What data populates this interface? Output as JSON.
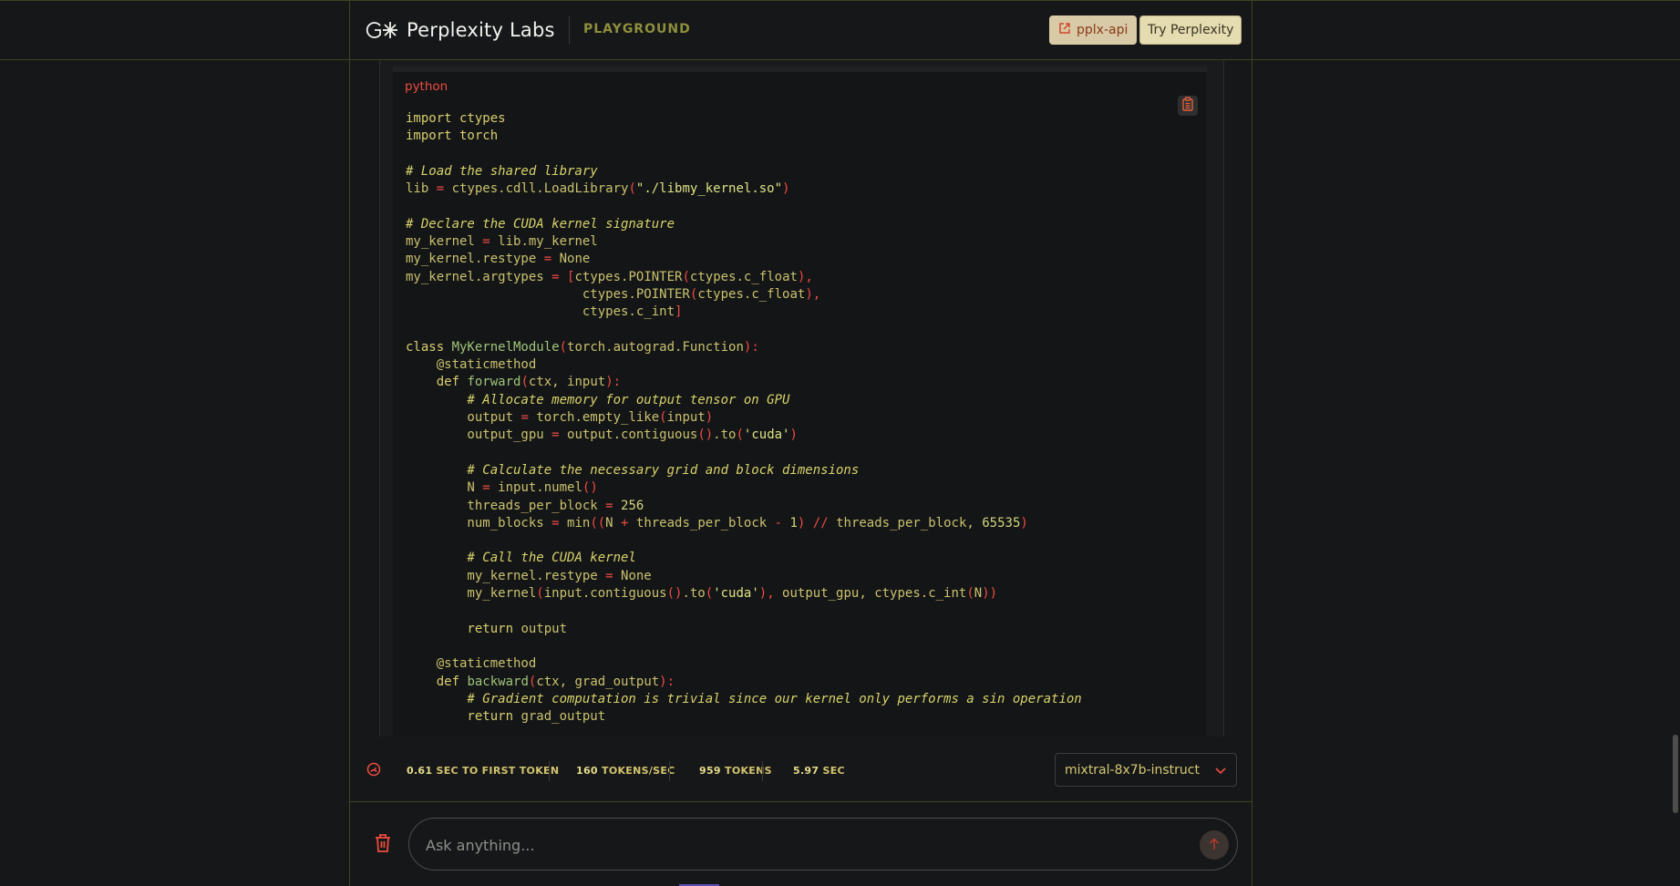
{
  "header": {
    "brand": "Perplexity Labs",
    "section": "PLAYGROUND",
    "api_button": "pplx-api",
    "try_button": "Try Perplexity"
  },
  "code": {
    "language": "python",
    "lines": [
      [
        [
          "kw",
          "import ctypes"
        ]
      ],
      [
        [
          "kw",
          "import torch"
        ]
      ],
      [],
      [
        [
          "cm",
          "# Load the shared library"
        ]
      ],
      [
        [
          "plain",
          "lib "
        ],
        [
          "op",
          "="
        ],
        [
          "plain",
          " ctypes.cdll.LoadLibrary"
        ],
        [
          "op",
          "("
        ],
        [
          "str",
          "\"./libmy_kernel.so\""
        ],
        [
          "op",
          ")"
        ]
      ],
      [],
      [
        [
          "cm",
          "# Declare the CUDA kernel signature"
        ]
      ],
      [
        [
          "plain",
          "my_kernel "
        ],
        [
          "op",
          "="
        ],
        [
          "plain",
          " lib.my_kernel"
        ]
      ],
      [
        [
          "plain",
          "my_kernel.restype "
        ],
        [
          "op",
          "="
        ],
        [
          "plain",
          " None"
        ]
      ],
      [
        [
          "plain",
          "my_kernel.argtypes "
        ],
        [
          "op",
          "="
        ],
        [
          "plain",
          " "
        ],
        [
          "op",
          "["
        ],
        [
          "plain",
          "ctypes.POINTER"
        ],
        [
          "op",
          "("
        ],
        [
          "plain",
          "ctypes.c_float"
        ],
        [
          "op",
          "),"
        ]
      ],
      [
        [
          "plain",
          "                       ctypes.POINTER"
        ],
        [
          "op",
          "("
        ],
        [
          "plain",
          "ctypes.c_float"
        ],
        [
          "op",
          "),"
        ]
      ],
      [
        [
          "plain",
          "                       ctypes.c_int"
        ],
        [
          "op",
          "]"
        ]
      ],
      [],
      [
        [
          "kw",
          "class "
        ],
        [
          "fn",
          "MyKernelModule"
        ],
        [
          "op",
          "("
        ],
        [
          "plain",
          "torch.autograd.Function"
        ],
        [
          "op",
          "):"
        ]
      ],
      [
        [
          "plain",
          "    @staticmethod"
        ]
      ],
      [
        [
          "kw",
          "    def "
        ],
        [
          "fn",
          "forward"
        ],
        [
          "op",
          "("
        ],
        [
          "plain",
          "ctx, input"
        ],
        [
          "op",
          "):"
        ]
      ],
      [
        [
          "cm",
          "        # Allocate memory for output tensor on GPU"
        ]
      ],
      [
        [
          "plain",
          "        output "
        ],
        [
          "op",
          "="
        ],
        [
          "plain",
          " torch.empty_like"
        ],
        [
          "op",
          "("
        ],
        [
          "plain",
          "input"
        ],
        [
          "op",
          ")"
        ]
      ],
      [
        [
          "plain",
          "        output_gpu "
        ],
        [
          "op",
          "="
        ],
        [
          "plain",
          " output.contiguous"
        ],
        [
          "op",
          "()"
        ],
        [
          "plain",
          ".to"
        ],
        [
          "op",
          "("
        ],
        [
          "str",
          "'cuda'"
        ],
        [
          "op",
          ")"
        ]
      ],
      [],
      [
        [
          "cm",
          "        # Calculate the necessary grid and block dimensions"
        ]
      ],
      [
        [
          "plain",
          "        N "
        ],
        [
          "op",
          "="
        ],
        [
          "plain",
          " input.numel"
        ],
        [
          "op",
          "()"
        ]
      ],
      [
        [
          "plain",
          "        threads_per_block "
        ],
        [
          "op",
          "="
        ],
        [
          "num",
          " 256"
        ]
      ],
      [
        [
          "plain",
          "        num_blocks "
        ],
        [
          "op",
          "="
        ],
        [
          "plain",
          " min"
        ],
        [
          "op",
          "(("
        ],
        [
          "plain",
          "N "
        ],
        [
          "op",
          "+"
        ],
        [
          "plain",
          " threads_per_block "
        ],
        [
          "op",
          "-"
        ],
        [
          "num",
          " 1"
        ],
        [
          "op",
          ")"
        ],
        [
          "plain",
          " "
        ],
        [
          "op",
          "//"
        ],
        [
          "plain",
          " threads_per_block, "
        ],
        [
          "num",
          "65535"
        ],
        [
          "op",
          ")"
        ]
      ],
      [],
      [
        [
          "cm",
          "        # Call the CUDA kernel"
        ]
      ],
      [
        [
          "plain",
          "        my_kernel.restype "
        ],
        [
          "op",
          "="
        ],
        [
          "plain",
          " None"
        ]
      ],
      [
        [
          "plain",
          "        my_kernel"
        ],
        [
          "op",
          "("
        ],
        [
          "plain",
          "input.contiguous"
        ],
        [
          "op",
          "()"
        ],
        [
          "plain",
          ".to"
        ],
        [
          "op",
          "("
        ],
        [
          "str",
          "'cuda'"
        ],
        [
          "op",
          "),"
        ],
        [
          "plain",
          " output_gpu, ctypes.c_int"
        ],
        [
          "op",
          "("
        ],
        [
          "plain",
          "N"
        ],
        [
          "op",
          "))"
        ]
      ],
      [],
      [
        [
          "kw",
          "        return "
        ],
        [
          "plain",
          "output"
        ]
      ],
      [],
      [
        [
          "plain",
          "    @staticmethod"
        ]
      ],
      [
        [
          "kw",
          "    def "
        ],
        [
          "fn",
          "backward"
        ],
        [
          "op",
          "("
        ],
        [
          "plain",
          "ctx, grad_output"
        ],
        [
          "op",
          "):"
        ]
      ],
      [
        [
          "cm",
          "        # Gradient computation is trivial since our kernel only performs a sin operation"
        ]
      ],
      [
        [
          "kw",
          "        return "
        ],
        [
          "plain",
          "grad_output"
        ]
      ]
    ]
  },
  "stats": {
    "first_token_value": "0.61",
    "first_token_label": "SEC TO FIRST TOKEN",
    "tps_value": "160",
    "tps_label": "TOKENS/SEC",
    "tokens_value": "959",
    "tokens_label": "TOKENS",
    "sec_value": "5.97",
    "sec_label": "SEC"
  },
  "model": {
    "selected": "mixtral-8x7b-instruct"
  },
  "input": {
    "placeholder": "Ask anything..."
  },
  "colors": {
    "accent": "#ee4c3f",
    "brand_olive": "#8d8f3b",
    "frame": "#3d4422"
  }
}
